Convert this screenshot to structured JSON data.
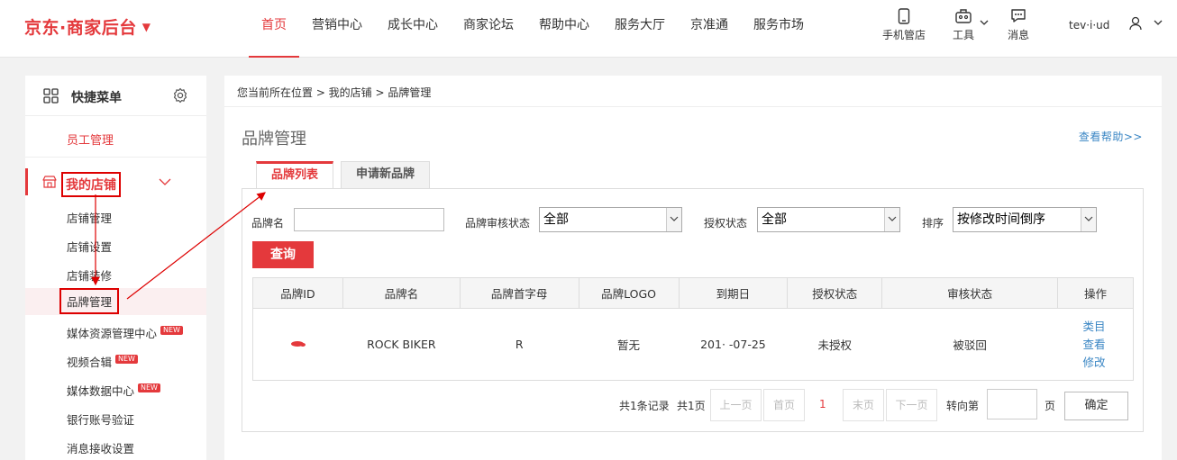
{
  "header": {
    "logo": "京东·商家后台",
    "logo_arrow": "▼",
    "nav": [
      "首页",
      "营销中心",
      "成长中心",
      "商家论坛",
      "帮助中心",
      "服务大厅",
      "京准通",
      "服务市场"
    ],
    "tools": {
      "mobile": "手机管店",
      "tools": "工具",
      "messages": "消息"
    },
    "user": "tev·i·ud"
  },
  "sidebar": {
    "quick_menu": "快捷菜单",
    "staff": "员工管理",
    "my_store": "我的店铺",
    "items": [
      "店铺管理",
      "店铺设置",
      "店铺装修",
      "品牌管理",
      "媒体资源管理中心",
      "视频合辑",
      "媒体数据中心",
      "银行账号验证",
      "消息接收设置"
    ],
    "new_badge": "NEW"
  },
  "main": {
    "breadcrumb": "您当前所在位置 > 我的店铺 > 品牌管理",
    "title": "品牌管理",
    "help": "查看帮助>>",
    "tabs": [
      "品牌列表",
      "申请新品牌"
    ],
    "filters": {
      "brand_name_label": "品牌名",
      "review_label": "品牌审核状态",
      "review_value": "全部",
      "auth_label": "授权状态",
      "auth_value": "全部",
      "sort_label": "排序",
      "sort_value": "按修改时间倒序"
    },
    "query_btn": "查询",
    "table": {
      "headers": [
        "品牌ID",
        "品牌名",
        "品牌首字母",
        "品牌LOGO",
        "到期日",
        "授权状态",
        "审核状态",
        "操作"
      ],
      "row": {
        "name": "ROCK BIKER",
        "initial": "R",
        "logo": "暂无",
        "expiry": "201· -07-25",
        "auth": "未授权",
        "review": "被驳回",
        "ops": [
          "类目",
          "查看",
          "修改"
        ]
      }
    },
    "pager": {
      "total": "共1条记录",
      "pages": "共1页",
      "prev": "上一页",
      "first": "首页",
      "current": "1",
      "last": "末页",
      "next": "下一页",
      "goto": "转向第",
      "page_unit": "页",
      "ok": "确定"
    }
  }
}
